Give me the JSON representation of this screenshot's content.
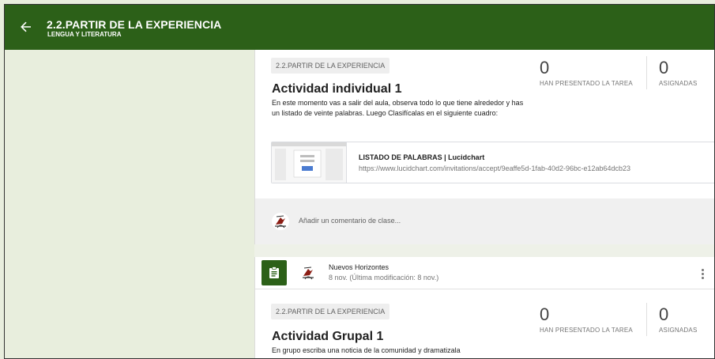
{
  "header": {
    "title": "2.2.PARTIR DE LA EXPERIENCIA",
    "subtitle": "LENGUA Y LITERATURA",
    "back_icon": "arrow-left-icon",
    "bar_color": "#2c6018"
  },
  "posts": [
    {
      "topic_chip": "2.2.PARTIR DE LA EXPERIENCIA",
      "title": "Actividad individual 1",
      "description": "En este momento vas a salir del aula, observa todo lo que tiene alrededor y has un listado de veinte palabras. Luego Clasifícalas en el siguiente cuadro:",
      "turned_in_count": "0",
      "turned_in_label": "HAN PRESENTADO LA TAREA",
      "assigned_count": "0",
      "assigned_label": "ASIGNADAS",
      "attachment": {
        "title": "LISTADO DE PALABRAS | Lucidchart",
        "url": "https://www.lucidchart.com/invitations/accept/9eaffe5d-1fab-40d2-96bc-e12ab64dcb23"
      },
      "comment_placeholder": "Añadir un comentario de clase..."
    },
    {
      "author": "Nuevos Horizontes",
      "date": "8 nov. (Última modificación: 8 nov.)",
      "topic_chip": "2.2.PARTIR DE LA EXPERIENCIA",
      "title": "Actividad Grupal 1",
      "description": "En grupo escriba una noticia de la comunidad y dramatizala",
      "turned_in_count": "0",
      "turned_in_label": "HAN PRESENTADO LA TAREA",
      "assigned_count": "0",
      "assigned_label": "ASIGNADAS",
      "assignment_icon": "assignment-icon",
      "menu_icon": "more-vert-icon"
    }
  ]
}
